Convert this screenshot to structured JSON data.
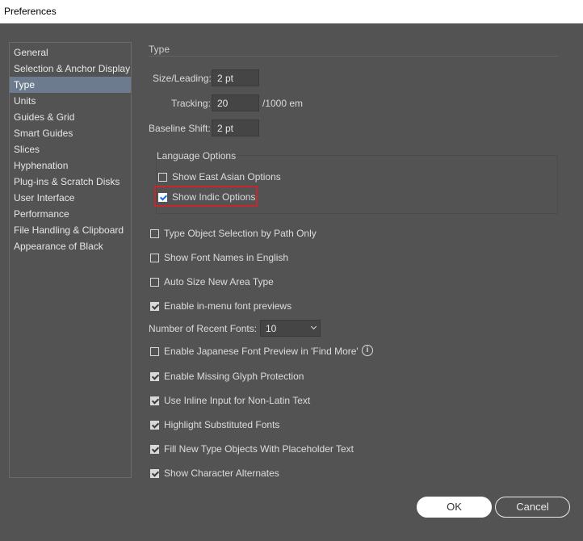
{
  "window": {
    "title": "Preferences"
  },
  "sidebar": {
    "items": [
      {
        "label": "General",
        "selected": false
      },
      {
        "label": "Selection & Anchor Display",
        "selected": false
      },
      {
        "label": "Type",
        "selected": true
      },
      {
        "label": "Units",
        "selected": false
      },
      {
        "label": "Guides & Grid",
        "selected": false
      },
      {
        "label": "Smart Guides",
        "selected": false
      },
      {
        "label": "Slices",
        "selected": false
      },
      {
        "label": "Hyphenation",
        "selected": false
      },
      {
        "label": "Plug-ins & Scratch Disks",
        "selected": false
      },
      {
        "label": "User Interface",
        "selected": false
      },
      {
        "label": "Performance",
        "selected": false
      },
      {
        "label": "File Handling & Clipboard",
        "selected": false
      },
      {
        "label": "Appearance of Black",
        "selected": false
      }
    ]
  },
  "main": {
    "section_title": "Type",
    "size_leading": {
      "label": "Size/Leading:",
      "value": "2 pt"
    },
    "tracking": {
      "label": "Tracking:",
      "value": "20",
      "suffix": "/1000 em"
    },
    "baseline_shift": {
      "label": "Baseline Shift:",
      "value": "2 pt"
    },
    "language_options": {
      "title": "Language Options",
      "east_asian": {
        "label": "Show East Asian Options",
        "checked": false
      },
      "indic": {
        "label": "Show Indic Options",
        "checked": true
      }
    },
    "type_object_selection": {
      "label": "Type Object Selection by Path Only",
      "checked": false
    },
    "font_names_english": {
      "label": "Show Font Names in English",
      "checked": false
    },
    "auto_size_area": {
      "label": "Auto Size New Area Type",
      "checked": false
    },
    "in_menu_previews": {
      "label": "Enable in-menu font previews",
      "checked": true
    },
    "recent_fonts": {
      "label": "Number of Recent Fonts:",
      "value": "10"
    },
    "japanese_preview": {
      "label": "Enable Japanese Font Preview in 'Find More'",
      "checked": false
    },
    "missing_glyph": {
      "label": "Enable Missing Glyph Protection",
      "checked": true
    },
    "inline_input": {
      "label": "Use Inline Input for Non-Latin Text",
      "checked": true
    },
    "highlight_substituted": {
      "label": "Highlight Substituted Fonts",
      "checked": true
    },
    "placeholder_text": {
      "label": "Fill New Type Objects With Placeholder Text",
      "checked": true
    },
    "character_alternates": {
      "label": "Show Character Alternates",
      "checked": true
    }
  },
  "buttons": {
    "ok": "OK",
    "cancel": "Cancel"
  },
  "colors": {
    "background": "#535353",
    "selection": "#6c7b8e",
    "highlight_box": "#c6262e",
    "checkbox_accent": "#1473e6"
  }
}
